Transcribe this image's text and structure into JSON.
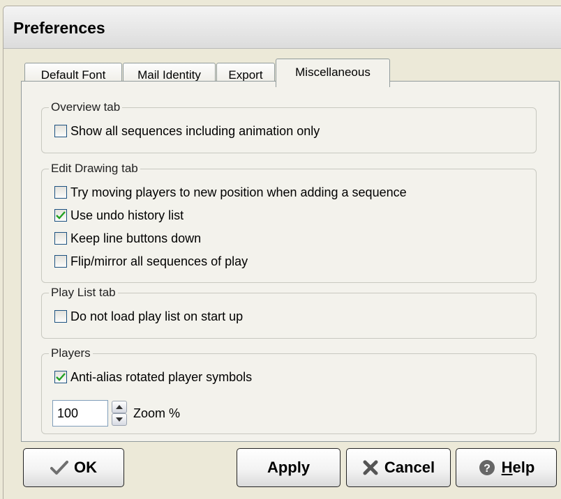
{
  "window": {
    "title": "Preferences"
  },
  "tabs": [
    {
      "label": "Default Font"
    },
    {
      "label": "Mail Identity"
    },
    {
      "label": "Export"
    },
    {
      "label": "Miscellaneous",
      "active": true
    }
  ],
  "groups": {
    "overview": {
      "legend": "Overview tab",
      "items": [
        {
          "label": "Show all sequences including animation only",
          "checked": false
        }
      ]
    },
    "edit_drawing": {
      "legend": "Edit Drawing tab",
      "items": [
        {
          "label": "Try moving players to new position when adding a sequence",
          "checked": false
        },
        {
          "label": "Use undo history list",
          "checked": true
        },
        {
          "label": "Keep line buttons down",
          "checked": false
        },
        {
          "label": "Flip/mirror all sequences of play",
          "checked": false
        }
      ]
    },
    "play_list": {
      "legend": "Play List tab",
      "items": [
        {
          "label": "Do not load play list on start up",
          "checked": false
        }
      ]
    },
    "players": {
      "legend": "Players",
      "items": [
        {
          "label": "Anti-alias rotated player symbols",
          "checked": true
        }
      ],
      "zoom_value": "100",
      "zoom_label": "Zoom %"
    }
  },
  "buttons": {
    "ok": "OK",
    "apply": "Apply",
    "cancel": "Cancel",
    "help": "Help"
  },
  "icons": {
    "ok": "checkmark-icon",
    "cancel": "x-cross-icon",
    "help": "question-icon"
  }
}
